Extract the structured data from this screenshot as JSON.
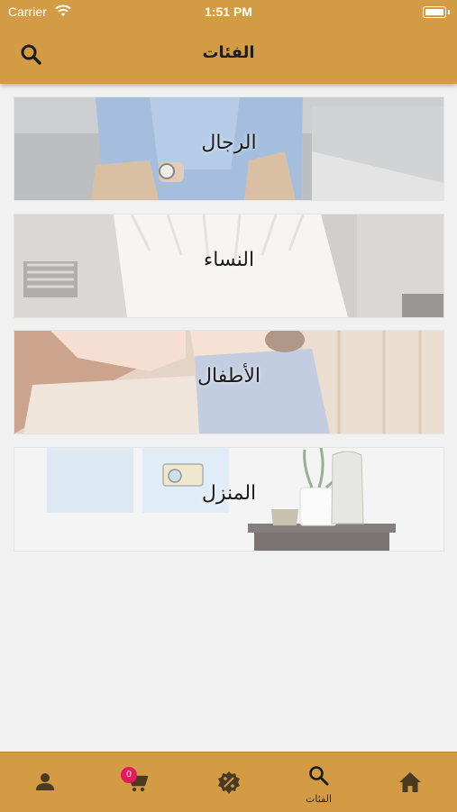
{
  "status_bar": {
    "carrier": "Carrier",
    "time": "1:51 PM"
  },
  "header": {
    "title": "الفئات",
    "search_icon": "search-icon"
  },
  "categories": [
    {
      "label": "الرجال"
    },
    {
      "label": "النساء"
    },
    {
      "label": "الأطفال"
    },
    {
      "label": "المنزل"
    }
  ],
  "bottom_nav": {
    "active_tab": "categories",
    "tabs": [
      {
        "id": "account",
        "icon": "person-icon"
      },
      {
        "id": "cart",
        "icon": "cart-icon",
        "badge": "0"
      },
      {
        "id": "offers",
        "icon": "discount-badge-icon"
      },
      {
        "id": "categories",
        "icon": "search-icon",
        "label": "الفئات"
      },
      {
        "id": "home",
        "icon": "home-icon"
      }
    ]
  },
  "colors": {
    "bar": "#d49b45",
    "background": "#f1f1f1",
    "badge": "#e6195a"
  }
}
